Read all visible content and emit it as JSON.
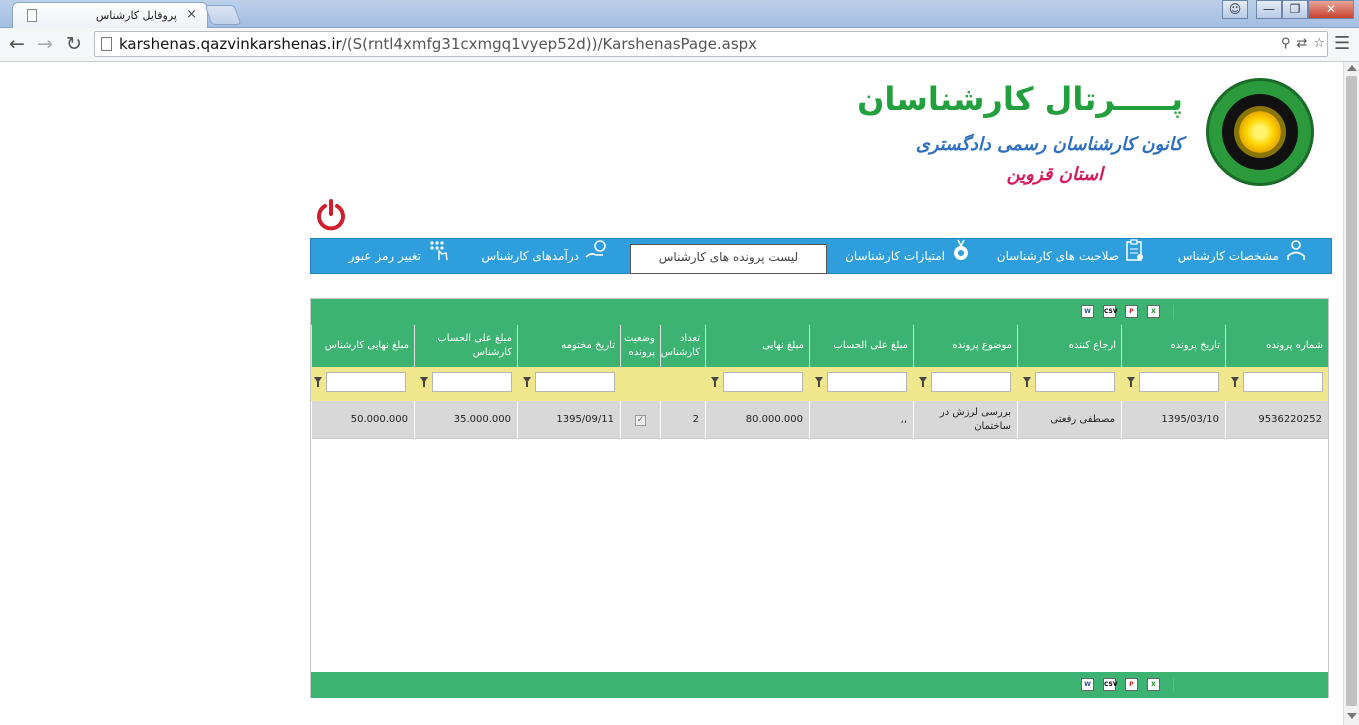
{
  "browser": {
    "tab_title": "پروفایل کارشناس",
    "tab_close": "×",
    "url_host": "karshenas.qazvinkarshenas.ir",
    "url_path": "/(S(rntl4xmfg31cxmgq1vyep52d))/KarshenasPage.aspx"
  },
  "header": {
    "title": "پـــــرتال کارشناسان",
    "subtitle": "کانون کارشناسان رسمی دادگستری",
    "province": "استان قزوین"
  },
  "nav": {
    "items": [
      {
        "label": "مشخصات کارشناس",
        "icon": "user-icon"
      },
      {
        "label": "صلاحیت های کارشناسان",
        "icon": "clipboard-icon"
      },
      {
        "label": "امتیازات کارشناسان",
        "icon": "medal-icon"
      },
      {
        "label": "لیست پرونده های کارشناس",
        "icon": "",
        "active": true
      },
      {
        "label": "درآمدهای کارشناس",
        "icon": "money-hand-icon"
      },
      {
        "label": "تغییر رمز عبور",
        "icon": "keypad-icon"
      }
    ]
  },
  "grid": {
    "export_labels": [
      "CSV"
    ],
    "columns": [
      "شماره پرونده",
      "تاریخ پرونده",
      "ارجاع کننده",
      "موضوع پرونده",
      "مبلغ علی الحساب",
      "مبلغ نهایی",
      "تعداد کارشناس",
      "وضعیت پرونده",
      "تاریخ مختومه",
      "مبلغ علی الحساب کارشناس",
      "مبلغ نهایی کارشناس"
    ],
    "rows": [
      {
        "file_no": "9536220252",
        "file_date": "1395/03/10",
        "referrer": "مصطفی رفعتی",
        "subject": "بررسی لرزش در ساختمان",
        "advance": ",,",
        "final": "80.000.000",
        "experts": "2",
        "status_check": "✓",
        "close_date": "1395/09/11",
        "expert_advance": "35.000.000",
        "expert_final": "50.000.000"
      }
    ]
  },
  "colors": {
    "green": "#3cb371",
    "nav_blue": "#2e9fdc",
    "filter_yellow": "#f0e68c",
    "title_green": "#22a03d",
    "subtitle_blue": "#2f6fc2",
    "province_pink": "#d41a5c",
    "power_red": "#d01e2e"
  }
}
